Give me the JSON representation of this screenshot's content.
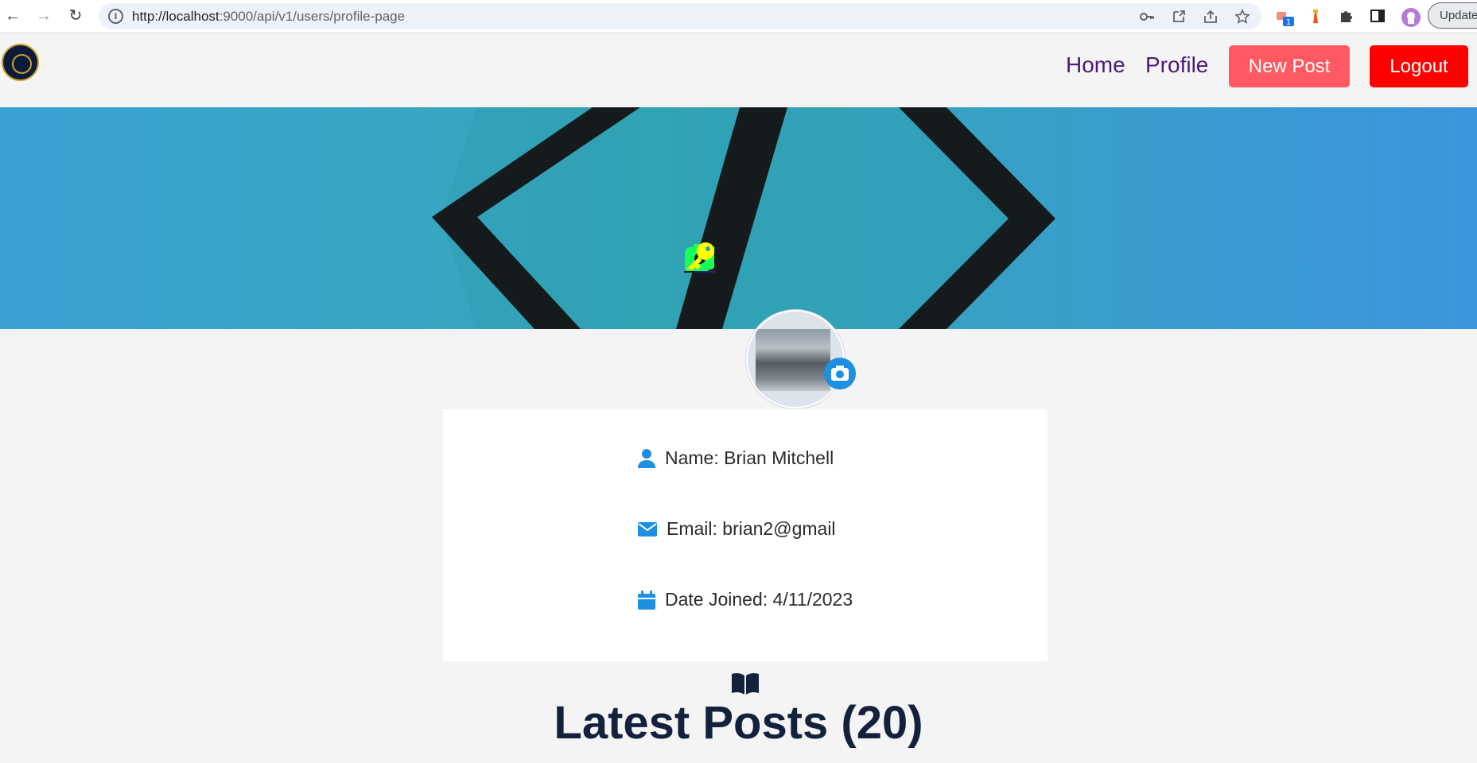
{
  "browser": {
    "url_host": "http://localhost",
    "url_rest": ":9000/api/v1/users/profile-page",
    "update_label": "Update",
    "extension_badge": "1"
  },
  "navbar": {
    "home_label": "Home",
    "profile_label": "Profile",
    "new_post_label": "New Post",
    "logout_label": "Logout"
  },
  "cover": {
    "actions": [
      "camera-icon",
      "edit-icon",
      "key-icon"
    ]
  },
  "profile": {
    "name_text": "Name: Brian Mitchell",
    "email_text": "Email: brian2@gmail",
    "joined_text": "Date Joined: 4/11/2023"
  },
  "posts": {
    "title": "Latest Posts (20)"
  },
  "colors": {
    "accent_blue": "#1e8fe1",
    "nav_link": "#4a1a7a",
    "new_post_btn": "#ff5a63",
    "logout_btn": "#ff0000",
    "cover_action_green": "#19ff5a",
    "cover_action_yellow": "#ffff00"
  }
}
